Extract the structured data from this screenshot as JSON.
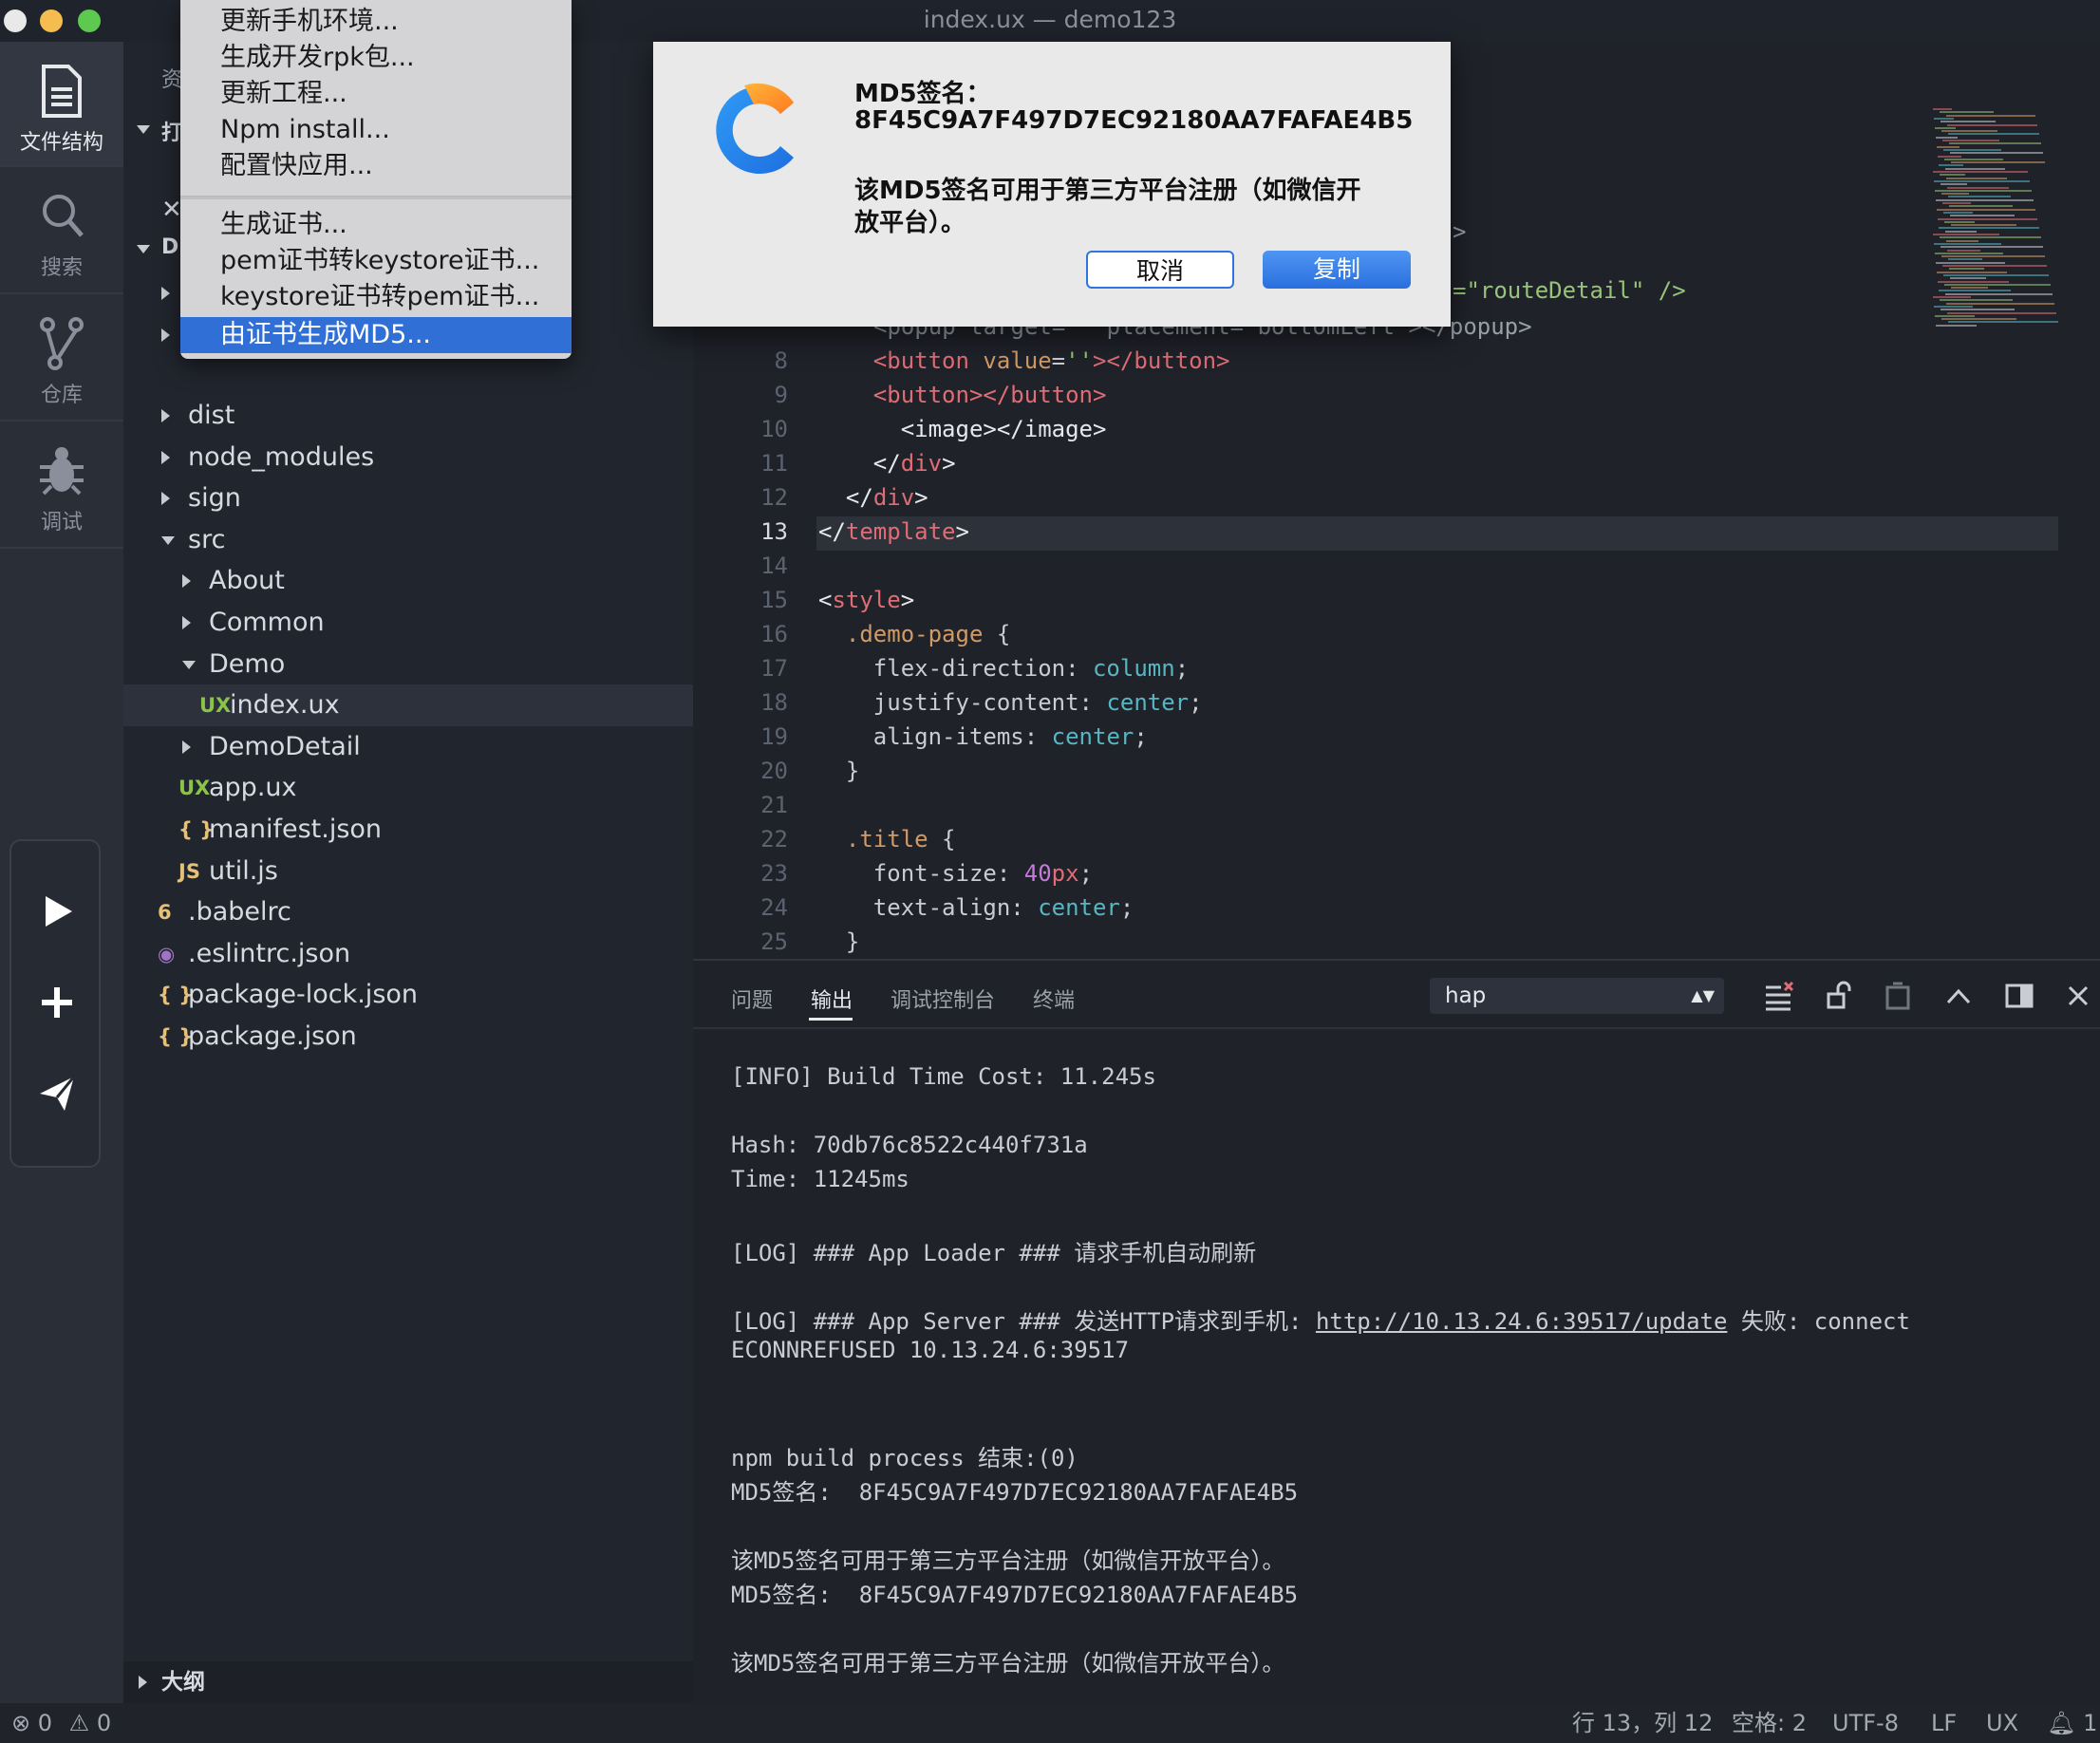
{
  "window": {
    "title": "index.ux — demo123"
  },
  "activity_bar": {
    "items": [
      {
        "label": "文件结构",
        "icon": "file-icon"
      },
      {
        "label": "搜索",
        "icon": "search-icon"
      },
      {
        "label": "仓库",
        "icon": "git-branch-icon"
      },
      {
        "label": "调试",
        "icon": "bug-icon"
      }
    ],
    "run_actions": [
      "play-icon",
      "plus-icon",
      "send-icon"
    ]
  },
  "sidebar": {
    "hidden_header": {
      "partial1": "资",
      "partial2": "打",
      "partial3": "DI"
    },
    "tree": [
      {
        "label": "dist",
        "type": "folder",
        "expanded": false
      },
      {
        "label": "node_modules",
        "type": "folder",
        "expanded": false
      },
      {
        "label": "sign",
        "type": "folder",
        "expanded": false
      },
      {
        "label": "src",
        "type": "folder",
        "expanded": true
      },
      {
        "label": "About",
        "type": "folder",
        "expanded": false
      },
      {
        "label": "Common",
        "type": "folder",
        "expanded": false
      },
      {
        "label": "Demo",
        "type": "folder",
        "expanded": true
      },
      {
        "label": "index.ux",
        "type": "file",
        "icon_text": "UX",
        "selected": true
      },
      {
        "label": "DemoDetail",
        "type": "folder",
        "expanded": false
      },
      {
        "label": "app.ux",
        "type": "file",
        "icon_text": "UX"
      },
      {
        "label": "manifest.json",
        "type": "file",
        "icon_text": "{ }"
      },
      {
        "label": "util.js",
        "type": "file",
        "icon_text": "JS"
      },
      {
        "label": ".babelrc",
        "type": "file",
        "icon_text": "6"
      },
      {
        "label": ".eslintrc.json",
        "type": "file",
        "icon_text": "◉"
      },
      {
        "label": "package-lock.json",
        "type": "file",
        "icon_text": "{ }"
      },
      {
        "label": "package.json",
        "type": "file",
        "icon_text": "{ }"
      }
    ],
    "outline_label": "大纲"
  },
  "context_menu": {
    "items": [
      "更新手机环境...",
      "生成开发rpk包...",
      "更新工程...",
      "Npm install...",
      "配置快应用...",
      "生成证书...",
      "pem证书转keystore证书...",
      "keystore证书转pem证书...",
      "由证书生成MD5..."
    ],
    "highlighted": "由证书生成MD5..."
  },
  "dialog": {
    "line1": "MD5签名：",
    "line2": "8F45C9A7F497D7EC92180AA7FAFAE4B5",
    "line3": "该MD5签名可用于第三方平台注册（如微信开",
    "line4": "放平台）。",
    "cancel_label": "取消",
    "copy_label": "复制"
  },
  "editor": {
    "partial_line_6": "=\"routeDetail\" />",
    "partial_line_5": ">",
    "line_7": "<popup target=\"\" placement=\"bottomLeft\"></popup>",
    "lines": [
      {
        "n": "8"
      },
      {
        "n": "9"
      },
      {
        "n": "10"
      },
      {
        "n": "11"
      },
      {
        "n": "12"
      },
      {
        "n": "13"
      },
      {
        "n": "14"
      },
      {
        "n": "15"
      },
      {
        "n": "16"
      },
      {
        "n": "17"
      },
      {
        "n": "18"
      },
      {
        "n": "19"
      },
      {
        "n": "20"
      },
      {
        "n": "21"
      },
      {
        "n": "22"
      },
      {
        "n": "23"
      },
      {
        "n": "24"
      },
      {
        "n": "25"
      }
    ],
    "active_line": "13"
  },
  "panel": {
    "tabs": [
      "问题",
      "输出",
      "调试控制台",
      "终端"
    ],
    "active_tab": "输出",
    "channel": "hap",
    "output": [
      "[INFO] Build Time Cost: 11.245s",
      "Hash: 70db76c8522c440f731a",
      "Time: 11245ms",
      "[LOG] ### App Loader ### 请求手机自动刷新",
      "[LOG] ### App Server ### 发送HTTP请求到手机: ",
      "http://10.13.24.6:39517/update",
      " 失败: connect",
      "ECONNREFUSED 10.13.24.6:39517",
      "npm build process 结束:(0)",
      "MD5签名:  8F45C9A7F497D7EC92180AA7FAFAE4B5",
      "该MD5签名可用于第三方平台注册（如微信开放平台）。",
      "MD5签名:  8F45C9A7F497D7EC92180AA7FAFAE4B5",
      "该MD5签名可用于第三方平台注册（如微信开放平台）。"
    ]
  },
  "status_bar": {
    "errors": "0",
    "warnings": "0",
    "position": "行 13，列 12",
    "spaces": "空格: 2",
    "encoding": "UTF-8",
    "eol": "LF",
    "language": "UX",
    "notifications": "1"
  },
  "colors": {
    "accent": "#2f6fd6",
    "tag": "#e06c75",
    "attr": "#d19a66",
    "string": "#98c379",
    "value": "#56b6c2",
    "number": "#c678dd"
  }
}
